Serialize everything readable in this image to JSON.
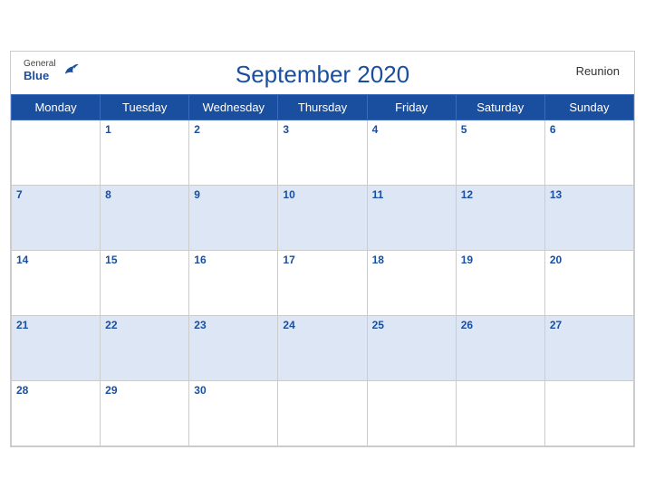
{
  "header": {
    "title": "September 2020",
    "region": "Reunion",
    "logo_general": "General",
    "logo_blue": "Blue"
  },
  "weekdays": [
    "Monday",
    "Tuesday",
    "Wednesday",
    "Thursday",
    "Friday",
    "Saturday",
    "Sunday"
  ],
  "weeks": [
    [
      null,
      1,
      2,
      3,
      4,
      5,
      6
    ],
    [
      7,
      8,
      9,
      10,
      11,
      12,
      13
    ],
    [
      14,
      15,
      16,
      17,
      18,
      19,
      20
    ],
    [
      21,
      22,
      23,
      24,
      25,
      26,
      27
    ],
    [
      28,
      29,
      30,
      null,
      null,
      null,
      null
    ]
  ]
}
